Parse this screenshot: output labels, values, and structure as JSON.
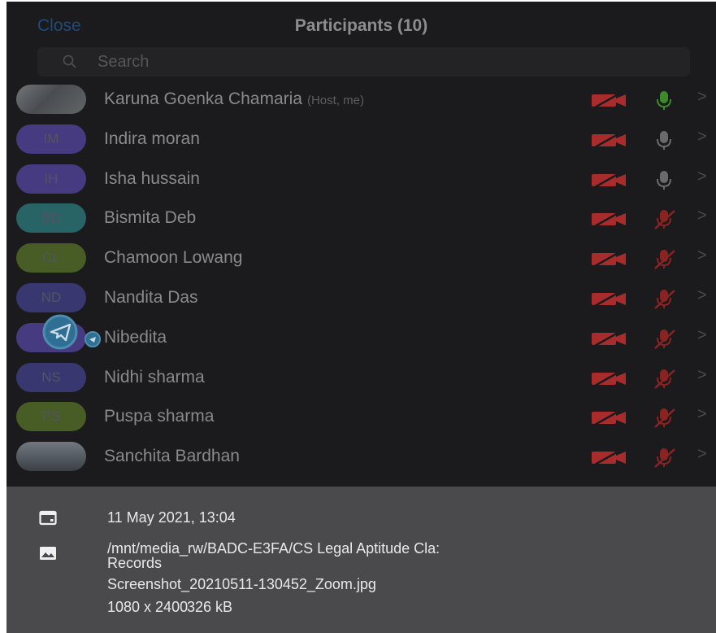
{
  "header": {
    "close_label": "Close",
    "title": "Participants (10)"
  },
  "search": {
    "placeholder": "Search"
  },
  "participants": [
    {
      "name": "Karuna Goenka Chamaria",
      "role": "(Host, me)",
      "initials": "",
      "avatar_color": "#8a8d90",
      "mic": "on"
    },
    {
      "name": "Indira moran",
      "role": "",
      "initials": "IM",
      "avatar_color": "#4b3f8c",
      "mic": "idle"
    },
    {
      "name": "Isha hussain",
      "role": "",
      "initials": "IH",
      "avatar_color": "#4b3f8c",
      "mic": "idle"
    },
    {
      "name": "Bismita Deb",
      "role": "",
      "initials": "BD",
      "avatar_color": "#2a6b6e",
      "mic": "muted"
    },
    {
      "name": "Chamoon Lowang",
      "role": "",
      "initials": "CL",
      "avatar_color": "#4d6426",
      "mic": "muted"
    },
    {
      "name": "Nandita Das",
      "role": "",
      "initials": "ND",
      "avatar_color": "#3c3b7a",
      "mic": "muted"
    },
    {
      "name": "Nibedita",
      "role": "",
      "initials": "",
      "avatar_color": "#4b3f8c",
      "mic": "muted"
    },
    {
      "name": "Nidhi sharma",
      "role": "",
      "initials": "NS",
      "avatar_color": "#3c3b7a",
      "mic": "muted"
    },
    {
      "name": "Puspa sharma",
      "role": "",
      "initials": "PS",
      "avatar_color": "#4d6426",
      "mic": "muted"
    },
    {
      "name": "Sanchita Bardhan",
      "role": "",
      "initials": "",
      "avatar_color": "#5b636b",
      "mic": "muted"
    }
  ],
  "colors": {
    "video_off": "#a82c2c",
    "mic_on": "#3c8a2a",
    "mic_idle": "#6a6a6e",
    "mic_muted": "#8b2323"
  },
  "file_info": {
    "date": "11 May 2021, 13:04",
    "path_line1": "/mnt/media_rw/BADC-E3FA/CS Legal Aptitude Cla:",
    "path_line2": "Records",
    "filename": "Screenshot_20210511-130452_Zoom.jpg",
    "dimensions": "1080 x 2400",
    "size": "326 kB"
  }
}
